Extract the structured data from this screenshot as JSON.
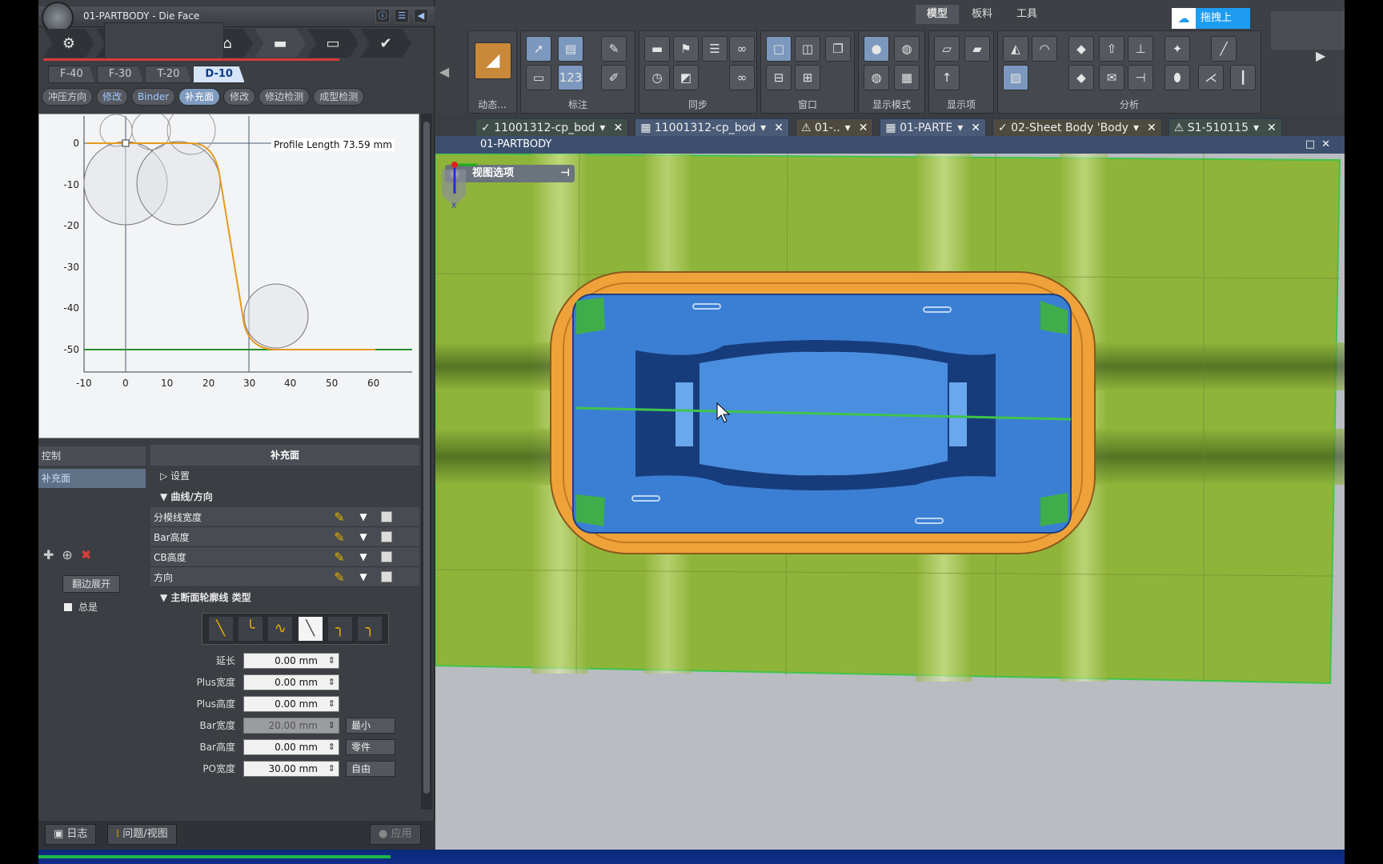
{
  "left": {
    "title": "01-PARTBODY - Die Face",
    "op_tabs": [
      "F-40",
      "F-30",
      "T-20",
      "D-10"
    ],
    "chips": [
      "冲压方向",
      "修改",
      "Binder",
      "补充面",
      "修改",
      "修边检测",
      "成型检测"
    ],
    "profile": {
      "label": "Profile Length 73.59 mm",
      "x_ticks": [
        "-10",
        "0",
        "10",
        "20",
        "30",
        "40",
        "50",
        "60"
      ],
      "y_ticks": [
        "0",
        "-10",
        "-20",
        "-30",
        "-40",
        "-50"
      ]
    },
    "control": {
      "header": "控制",
      "item": "补充面",
      "expand_button": "翻边展开",
      "total_label": "总是"
    },
    "props": {
      "header": "补充面",
      "settings": "设置",
      "curve_section": "曲线/方向",
      "rows": [
        "分模线宽度",
        "Bar高度",
        "CB高度",
        "方向"
      ],
      "profile_section": "主断面轮廓线 类型",
      "shape_icons": [
        "╲",
        "╰",
        "∿",
        "╲",
        "╮",
        "╮"
      ],
      "num_rows": [
        {
          "label": "延长",
          "value": "0.00 mm"
        },
        {
          "label": "Plus宽度",
          "value": "0.00 mm"
        },
        {
          "label": "Plus高度",
          "value": "0.00 mm"
        },
        {
          "label": "Bar宽度",
          "value": "20.00 mm",
          "mode": "最小"
        },
        {
          "label": "Bar高度",
          "value": "0.00 mm",
          "mode": "零件"
        },
        {
          "label": "PO宽度",
          "value": "30.00 mm",
          "mode": "自由"
        }
      ]
    },
    "footer": {
      "log": "日志",
      "issues": "问题/视图",
      "apply": "应用"
    }
  },
  "ribbon": {
    "tabs": [
      "模型",
      "板料",
      "工具"
    ],
    "cloud_label": "拖拽上",
    "groups": [
      "动态...",
      "标注",
      "同步",
      "窗口",
      "显示模式",
      "显示项",
      "分析"
    ]
  },
  "doc_tabs": [
    {
      "label": "✓ 11001312-cp_bod",
      "kind": "ok"
    },
    {
      "label": "▦ 11001312-cp_bod",
      "kind": "plain"
    },
    {
      "label": "⚠ 01-..",
      "kind": "warn"
    },
    {
      "label": "▦ 01-PARTE",
      "kind": "plain"
    },
    {
      "label": "✓ 02-Sheet Body 'Body",
      "kind": "warn"
    },
    {
      "label": "⚠ S1-510115",
      "kind": "ok"
    }
  ],
  "viewport": {
    "title": "01-PARTBODY",
    "view_options": "视图选项",
    "triad_axis": "X"
  },
  "colors": {
    "binder_green": "#8fb43a",
    "part_blue": "#3b7fd4",
    "addendum_orange": "#f0a23a",
    "profile_curve": "#e69a1e"
  }
}
